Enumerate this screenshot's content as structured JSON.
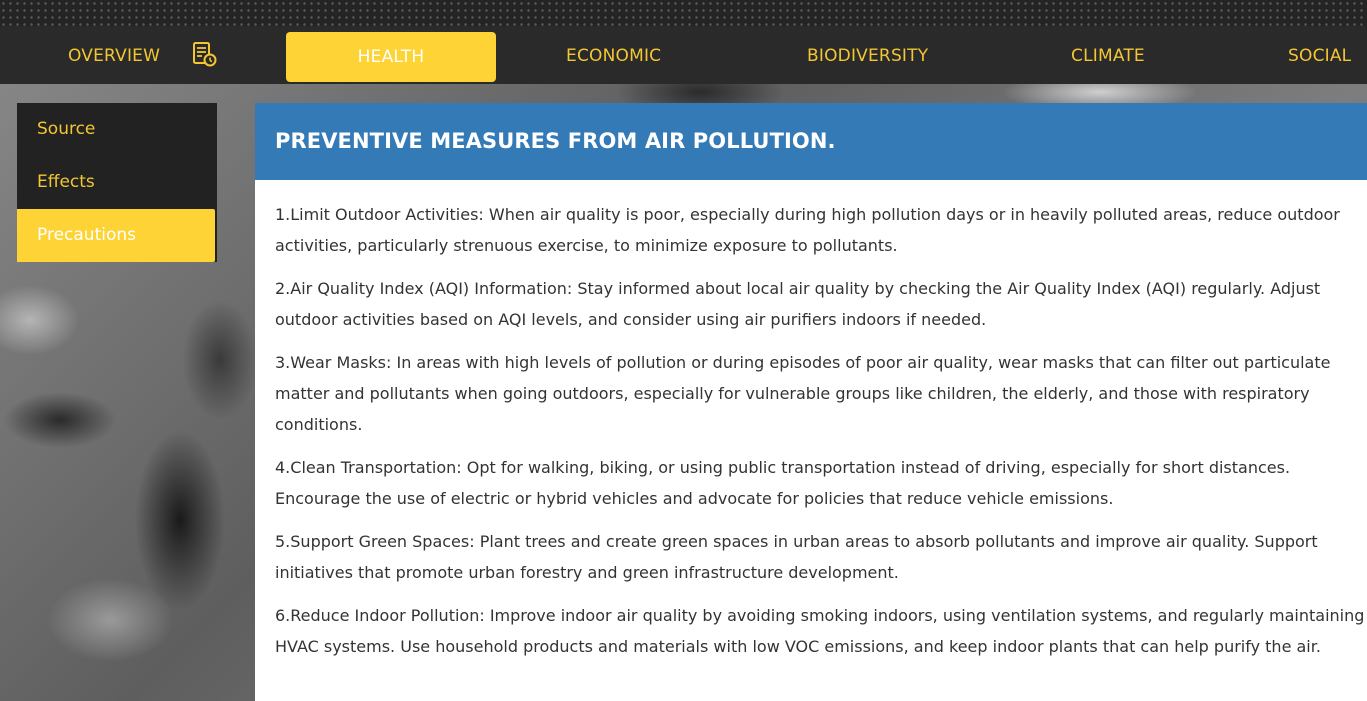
{
  "nav": {
    "items": [
      {
        "label": "OVERVIEW",
        "active": false
      },
      {
        "label": "HEALTH",
        "active": true
      },
      {
        "label": "ECONOMIC",
        "active": false
      },
      {
        "label": "BIODIVERSITY",
        "active": false
      },
      {
        "label": "CLIMATE",
        "active": false
      },
      {
        "label": "SOCIAL",
        "active": false
      }
    ],
    "overview_icon": "report-icon"
  },
  "sidebar": {
    "items": [
      {
        "label": "Source",
        "active": false
      },
      {
        "label": "Effects",
        "active": false
      },
      {
        "label": "Precautions",
        "active": true
      }
    ]
  },
  "content": {
    "title": "PREVENTIVE MEASURES FROM AIR POLLUTION.",
    "paragraphs": [
      "1.Limit Outdoor Activities: When air quality is poor, especially during high pollution days or in heavily polluted areas, reduce outdoor activities, particularly strenuous exercise, to minimize exposure to pollutants.",
      "2.Air Quality Index (AQI) Information: Stay informed about local air quality by checking the Air Quality Index (AQI) regularly. Adjust outdoor activities based on AQI levels, and consider using air purifiers indoors if needed.",
      "3.Wear Masks: In areas with high levels of pollution or during episodes of poor air quality, wear masks that can filter out particulate matter and pollutants when going outdoors, especially for vulnerable groups like children, the elderly, and those with respiratory conditions.",
      "4.Clean Transportation: Opt for walking, biking, or using public transportation instead of driving, especially for short distances. Encourage the use of electric or hybrid vehicles and advocate for policies that reduce vehicle emissions.",
      "5.Support Green Spaces: Plant trees and create green spaces in urban areas to absorb pollutants and improve air quality. Support initiatives that promote urban forestry and green infrastructure development.",
      "6.Reduce Indoor Pollution: Improve indoor air quality by avoiding smoking indoors, using ventilation systems, and regularly maintaining HVAC systems. Use household products and materials with low VOC emissions, and keep indoor plants that can help purify the air."
    ]
  },
  "colors": {
    "accent": "#fdd335",
    "nav_text": "#f3c632",
    "header_blue": "#337ab7",
    "dark_bar": "#2a2a2a"
  }
}
